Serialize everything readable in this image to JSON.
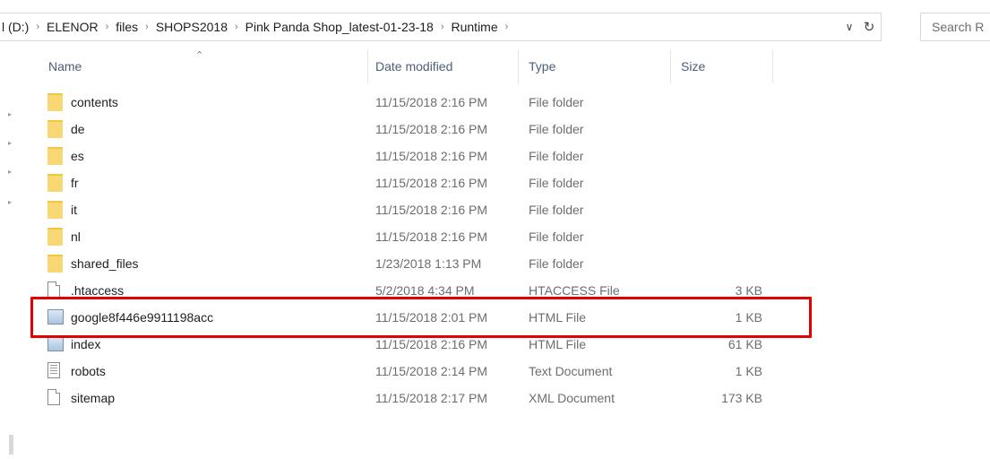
{
  "address": {
    "crumbs": [
      "l (D:)",
      "ELENOR",
      "files",
      "SHOPS2018",
      "Pink Panda Shop_latest-01-23-18",
      "Runtime"
    ]
  },
  "search": {
    "placeholder": "Search R"
  },
  "columns": {
    "name": "Name",
    "date": "Date modified",
    "type": "Type",
    "size": "Size"
  },
  "files": [
    {
      "name": "contents",
      "date": "11/15/2018 2:16 PM",
      "type": "File folder",
      "size": "",
      "icon": "folder-icon"
    },
    {
      "name": "de",
      "date": "11/15/2018 2:16 PM",
      "type": "File folder",
      "size": "",
      "icon": "folder-icon"
    },
    {
      "name": "es",
      "date": "11/15/2018 2:16 PM",
      "type": "File folder",
      "size": "",
      "icon": "folder-icon"
    },
    {
      "name": "fr",
      "date": "11/15/2018 2:16 PM",
      "type": "File folder",
      "size": "",
      "icon": "folder-icon"
    },
    {
      "name": "it",
      "date": "11/15/2018 2:16 PM",
      "type": "File folder",
      "size": "",
      "icon": "folder-icon"
    },
    {
      "name": "nl",
      "date": "11/15/2018 2:16 PM",
      "type": "File folder",
      "size": "",
      "icon": "folder-icon"
    },
    {
      "name": "shared_files",
      "date": "1/23/2018 1:13 PM",
      "type": "File folder",
      "size": "",
      "icon": "folder-icon"
    },
    {
      "name": ".htaccess",
      "date": "5/2/2018 4:34 PM",
      "type": "HTACCESS File",
      "size": "3 KB",
      "icon": "file-icon"
    },
    {
      "name": "google8f446e9911198acc",
      "date": "11/15/2018 2:01 PM",
      "type": "HTML File",
      "size": "1 KB",
      "icon": "html-file-icon"
    },
    {
      "name": "index",
      "date": "11/15/2018 2:16 PM",
      "type": "HTML File",
      "size": "61 KB",
      "icon": "html-file-icon"
    },
    {
      "name": "robots",
      "date": "11/15/2018 2:14 PM",
      "type": "Text Document",
      "size": "1 KB",
      "icon": "text-file-icon"
    },
    {
      "name": "sitemap",
      "date": "11/15/2018 2:17 PM",
      "type": "XML Document",
      "size": "173 KB",
      "icon": "file-icon"
    }
  ],
  "highlighted_row": 8,
  "colors": {
    "highlight": "#e40000",
    "folder": "#f8d775",
    "header_text": "#4c607a"
  }
}
